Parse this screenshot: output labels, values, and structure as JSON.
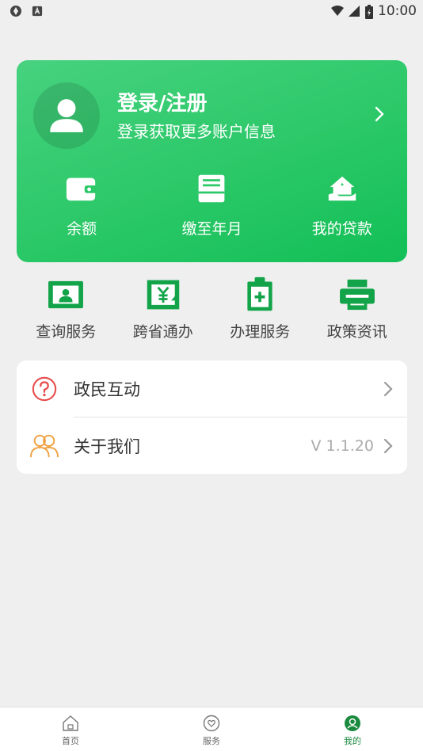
{
  "status_bar": {
    "time": "10:00"
  },
  "account": {
    "title": "登录/注册",
    "subtitle": "登录获取更多账户信息",
    "actions": [
      {
        "label": "余额",
        "icon": "wallet-icon"
      },
      {
        "label": "缴至年月",
        "icon": "calendar-register-icon"
      },
      {
        "label": "我的贷款",
        "icon": "house-loan-icon"
      }
    ]
  },
  "services": [
    {
      "label": "查询服务",
      "icon": "id-card-icon"
    },
    {
      "label": "跨省通办",
      "icon": "yuan-icon"
    },
    {
      "label": "办理服务",
      "icon": "clipboard-icon"
    },
    {
      "label": "政策资讯",
      "icon": "printer-icon"
    }
  ],
  "list": {
    "interaction": {
      "label": "政民互动",
      "icon": "question-circle-icon"
    },
    "about": {
      "label": "关于我们",
      "version": "V 1.1.20",
      "icon": "users-icon"
    }
  },
  "bottom_nav": [
    {
      "label": "首页",
      "icon": "home-icon"
    },
    {
      "label": "服务",
      "icon": "heart-icon"
    },
    {
      "label": "我的",
      "icon": "profile-icon",
      "active": true
    }
  ],
  "colors": {
    "accent": "#1a8a3e",
    "card_green": "#2bc868",
    "icon_green": "#13a44a",
    "question_red": "#e84c4c",
    "users_orange": "#f0a040"
  }
}
